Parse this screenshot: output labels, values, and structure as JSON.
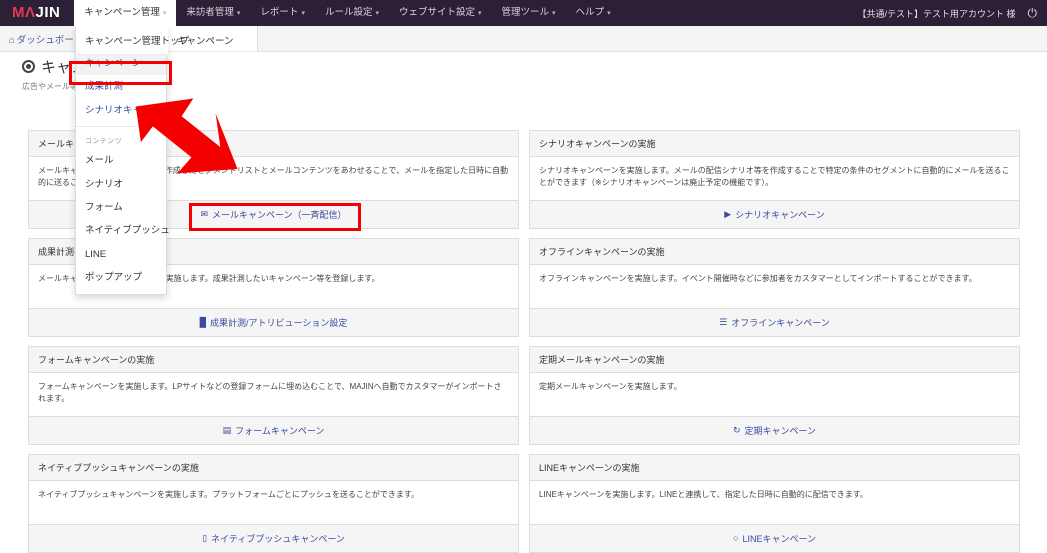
{
  "brand": {
    "prefix": "MΛ",
    "suffix": "JIN"
  },
  "topnav": {
    "items": [
      {
        "label": "キャンペーン管理",
        "caret": "▾",
        "open": true
      },
      {
        "label": "来訪者管理",
        "caret": "▾",
        "open": false
      },
      {
        "label": "レポート",
        "caret": "▾",
        "open": false
      },
      {
        "label": "ルール設定",
        "caret": "▾",
        "open": false
      },
      {
        "label": "ウェブサイト設定",
        "caret": "▾",
        "open": false
      },
      {
        "label": "管理ツール",
        "caret": "▾",
        "open": false
      },
      {
        "label": "ヘルプ",
        "caret": "▾",
        "open": false
      }
    ],
    "account": "【共通/テスト】テスト用アカウント 様",
    "power_icon": "⏻"
  },
  "breadcrumb": {
    "home_icon": "⌂",
    "items": [
      {
        "label": "ダッシュボード",
        "current": false
      },
      {
        "label": "キャンペーン",
        "current": true
      }
    ]
  },
  "page": {
    "title": "キャンペーン",
    "subtitle": "広告やメール等"
  },
  "dropdown": {
    "top_label": "キャンペーン管理トップ",
    "wide_label": "キャンペーン",
    "items": [
      {
        "label": "キャンペーン",
        "active": true
      },
      {
        "label": "成果計測",
        "active": false
      },
      {
        "label": "シナリオキャンバス",
        "active": false
      }
    ],
    "group_label": "コンテンツ",
    "content_items": [
      {
        "label": "メール"
      },
      {
        "label": "シナリオ"
      },
      {
        "label": "フォーム"
      },
      {
        "label": "ネイティブプッシュ"
      },
      {
        "label": "LINE"
      },
      {
        "label": "ポップアップ"
      }
    ]
  },
  "colors": {
    "navbar": "#2b2035",
    "brand_accent": "#e23b4e",
    "link": "#3a4ba0",
    "highlight": "#f40000",
    "card_head": "#f5f5f5"
  },
  "cards": [
    {
      "title": "メールキャンペーンの実施",
      "body": "メールキャンペーンを実施します。作成したセグメントリストとメールコンテンツをあわせることで、メールを指定した日時に自動的に送ることができます。",
      "link": "メールキャンペーン（一斉配信）",
      "icon": "✉",
      "icon_name": "envelope-icon"
    },
    {
      "title": "シナリオキャンペーンの実施",
      "body": "シナリオキャンペーンを実施します。メールの配信シナリオ等を作成することで特定の条件のセグメントに自動的にメールを送ることができます（※シナリオキャンペーンは廃止予定の機能です）。",
      "link": "シナリオキャンペーン",
      "icon": "▶",
      "icon_name": "play-icon"
    },
    {
      "title": "成果計測の実施",
      "body": "メールキャンペーン等の成果計測を実施します。成果計測したいキャンペーン等を登録します。",
      "link": "成果計測/アトリビューション設定",
      "icon": "█",
      "icon_name": "bar-chart-icon"
    },
    {
      "title": "オフラインキャンペーンの実施",
      "body": "オフラインキャンペーンを実施します。イベント開催時などに参加者をカスタマーとしてインポートすることができます。",
      "link": "オフラインキャンペーン",
      "icon": "☰",
      "icon_name": "calendar-icon"
    },
    {
      "title": "フォームキャンペーンの実施",
      "body": "フォームキャンペーンを実施します。LPサイトなどの登録フォームに埋め込むことで、MAJINへ自動でカスタマーがインポートされます。",
      "link": "フォームキャンペーン",
      "icon": "▤",
      "icon_name": "form-icon"
    },
    {
      "title": "定期メールキャンペーンの実施",
      "body": "定期メールキャンペーンを実施します。",
      "link": "定期キャンペーン",
      "icon": "↻",
      "icon_name": "refresh-icon"
    },
    {
      "title": "ネイティブプッシュキャンペーンの実施",
      "body": "ネイティブプッシュキャンペーンを実施します。プラットフォームごとにプッシュを送ることができます。",
      "link": "ネイティブプッシュキャンペーン",
      "icon": "▯",
      "icon_name": "mobile-icon"
    },
    {
      "title": "LINEキャンペーンの実施",
      "body": "LINEキャンペーンを実施します。LINEと連携して、指定した日時に自動的に配信できます。",
      "link": "LINEキャンペーン",
      "icon": "○",
      "icon_name": "chat-bubble-icon"
    }
  ]
}
